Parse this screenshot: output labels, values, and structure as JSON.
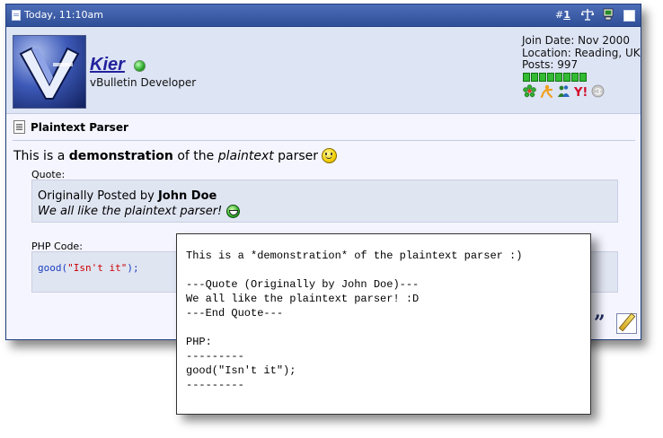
{
  "post": {
    "date": "Today, 11:10am",
    "number_prefix": "#",
    "number": "1",
    "icons": [
      "document-icon",
      "scale-icon",
      "computer-icon",
      "checkbox-icon"
    ]
  },
  "user": {
    "name": "Kier",
    "title": "vBulletin Developer",
    "join_date": "Join Date: Nov 2000",
    "location": "Location: Reading, UK",
    "posts": "Posts: 997",
    "reputation_pips": 8,
    "contact_icons": [
      "icq-icon",
      "aim-icon",
      "msn-icon",
      "yahoo-icon",
      "skype-icon"
    ]
  },
  "message": {
    "title": "Plaintext Parser",
    "text_pre": "This is a ",
    "text_bold": "demonstration",
    "text_mid": " of the ",
    "text_italic": "plaintext",
    "text_post": " parser"
  },
  "quote": {
    "label": "Quote:",
    "posted_by_prefix": "Originally Posted by ",
    "author": "John Doe",
    "body": "We all like the plaintext parser!"
  },
  "php": {
    "label": "PHP Code:",
    "fn": "good(",
    "str": "\"Isn't it\"",
    "end": ");"
  },
  "plaintext": {
    "line1": "This is a *demonstration* of the plaintext parser :)",
    "line2": "",
    "line3": "---Quote (Originally by John Doe)---",
    "line4": "We all like the plaintext parser! :D",
    "line5": "---End Quote---",
    "line6": "",
    "line7": "PHP:",
    "line8": "---------",
    "line9": "good(\"Isn't it\");",
    "line10": "---------"
  },
  "colors": {
    "header": "#2f4f98",
    "username": "#22229c",
    "user_band": "#dde4f4",
    "quote_bg": "#e0e5f2"
  }
}
